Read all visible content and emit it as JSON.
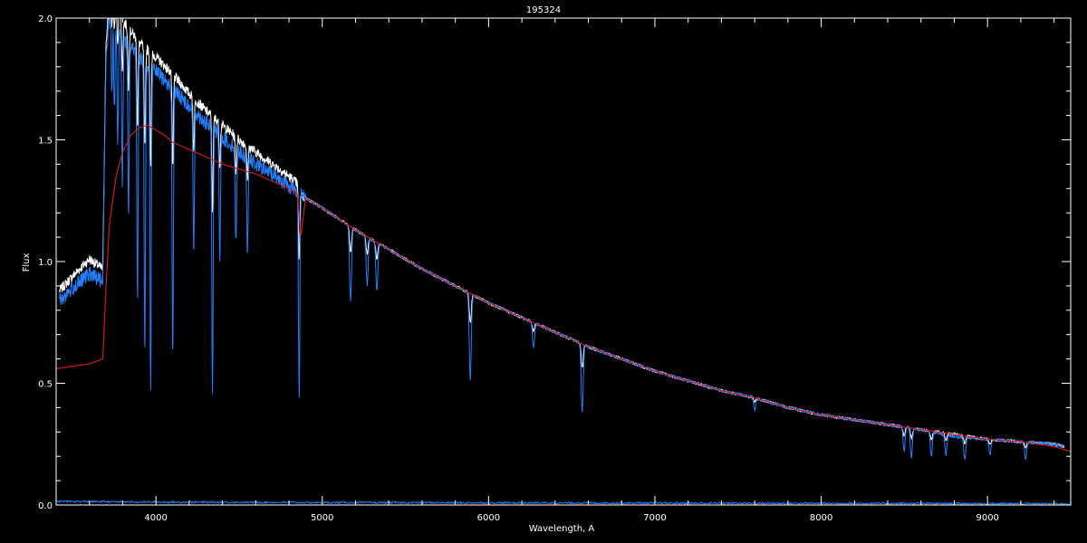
{
  "chart_data": {
    "type": "line",
    "title": "195324",
    "xlabel": "Wavelength, A",
    "ylabel": "Flux",
    "xlim": [
      3400,
      9500
    ],
    "ylim": [
      0.0,
      2.0
    ],
    "xticks": [
      4000,
      5000,
      6000,
      7000,
      8000,
      9000
    ],
    "xtick_labels": [
      "4000",
      "5000",
      "6000",
      "7000",
      "8000",
      "9000"
    ],
    "yticks": [
      0.0,
      0.5,
      1.0,
      1.5,
      2.0
    ],
    "ytick_labels": [
      "0.0",
      "0.5",
      "1.0",
      "1.5",
      "2.0"
    ],
    "grid": false,
    "background": "#000000",
    "axis_color": "#ffffff",
    "series": [
      {
        "color": "#ffffff",
        "width": 1,
        "x": [
          3420,
          3500,
          3600,
          3680,
          3700,
          3720,
          3750,
          3800,
          3900,
          4000,
          4100,
          4200,
          4300,
          4400,
          4500,
          4600,
          4700,
          4800,
          4850,
          4880,
          5000,
          5200,
          5400,
          5600,
          5800,
          6000,
          6200,
          6400,
          6600,
          6800,
          7000,
          7200,
          7400,
          7600,
          7800,
          8000,
          8200,
          8400,
          8600,
          8800,
          9000,
          9200,
          9400,
          9460
        ],
        "y": [
          0.88,
          0.94,
          1.01,
          0.97,
          1.9,
          2.05,
          2.1,
          1.99,
          1.9,
          1.84,
          1.77,
          1.69,
          1.62,
          1.56,
          1.5,
          1.45,
          1.4,
          1.35,
          1.32,
          1.27,
          1.22,
          1.13,
          1.05,
          0.97,
          0.9,
          0.83,
          0.77,
          0.71,
          0.65,
          0.6,
          0.55,
          0.51,
          0.47,
          0.44,
          0.4,
          0.37,
          0.35,
          0.33,
          0.31,
          0.29,
          0.27,
          0.26,
          0.25,
          0.24
        ]
      },
      {
        "color": "#1e7fff",
        "width": 1,
        "x": [
          3420,
          3500,
          3600,
          3680,
          3700,
          3720,
          3750,
          3800,
          3900,
          4000,
          4100,
          4200,
          4300,
          4400,
          4500,
          4600,
          4700,
          4800,
          4850,
          4880,
          5000,
          5200,
          5400,
          5600,
          5800,
          6000,
          6200,
          6400,
          6600,
          6800,
          7000,
          7200,
          7400,
          7600,
          7800,
          8000,
          8200,
          8400,
          8600,
          8800,
          9000,
          9200,
          9400,
          9460
        ],
        "y": [
          0.84,
          0.89,
          0.95,
          0.92,
          1.85,
          2.0,
          2.02,
          1.92,
          1.84,
          1.78,
          1.71,
          1.64,
          1.57,
          1.51,
          1.45,
          1.4,
          1.36,
          1.31,
          1.29,
          1.27,
          1.22,
          1.13,
          1.05,
          0.97,
          0.9,
          0.83,
          0.77,
          0.71,
          0.65,
          0.6,
          0.55,
          0.51,
          0.47,
          0.44,
          0.4,
          0.37,
          0.35,
          0.33,
          0.31,
          0.28,
          0.27,
          0.26,
          0.25,
          0.24
        ]
      },
      {
        "color": "#d01a1a",
        "width": 1.2,
        "x": [
          3400,
          3500,
          3600,
          3680,
          3700,
          3720,
          3760,
          3800,
          3850,
          3900,
          3950,
          4000,
          4050,
          4100,
          4200,
          4300,
          4400,
          4500,
          4600,
          4700,
          4800,
          4850,
          4870,
          4900,
          5000,
          5200,
          5400,
          5600,
          5800,
          6000,
          6200,
          6400,
          6600,
          6800,
          7000,
          7200,
          7400,
          7600,
          7800,
          8000,
          8200,
          8400,
          8600,
          8800,
          9000,
          9200,
          9400,
          9500
        ],
        "y": [
          0.56,
          0.57,
          0.58,
          0.6,
          0.9,
          1.15,
          1.35,
          1.45,
          1.52,
          1.55,
          1.56,
          1.54,
          1.52,
          1.49,
          1.46,
          1.43,
          1.4,
          1.38,
          1.36,
          1.33,
          1.3,
          1.28,
          1.1,
          1.26,
          1.22,
          1.13,
          1.05,
          0.97,
          0.9,
          0.83,
          0.77,
          0.71,
          0.65,
          0.6,
          0.55,
          0.51,
          0.47,
          0.44,
          0.4,
          0.37,
          0.35,
          0.33,
          0.31,
          0.29,
          0.27,
          0.26,
          0.24,
          0.22
        ]
      },
      {
        "color": "#1e7fff",
        "width": 1,
        "x": [
          3400,
          4000,
          5000,
          6000,
          7000,
          8000,
          9000,
          9500
        ],
        "y": [
          0.015,
          0.012,
          0.01,
          0.009,
          0.008,
          0.007,
          0.006,
          0.005
        ]
      }
    ],
    "absorption_lines": [
      {
        "x": 3735,
        "depth": 0.3
      },
      {
        "x": 3750,
        "depth": 0.4
      },
      {
        "x": 3770,
        "depth": 0.5
      },
      {
        "x": 3798,
        "depth": 0.6
      },
      {
        "x": 3835,
        "depth": 0.7
      },
      {
        "x": 3889,
        "depth": 1.0
      },
      {
        "x": 3933,
        "depth": 1.2
      },
      {
        "x": 3968,
        "depth": 1.3
      },
      {
        "x": 4101,
        "depth": 1.1
      },
      {
        "x": 4227,
        "depth": 0.6
      },
      {
        "x": 4340,
        "depth": 1.1
      },
      {
        "x": 4384,
        "depth": 0.5
      },
      {
        "x": 4481,
        "depth": 0.4
      },
      {
        "x": 4550,
        "depth": 0.4
      },
      {
        "x": 4861,
        "depth": 0.85
      },
      {
        "x": 5170,
        "depth": 0.3
      },
      {
        "x": 5270,
        "depth": 0.2
      },
      {
        "x": 5328,
        "depth": 0.2
      },
      {
        "x": 5890,
        "depth": 0.35
      },
      {
        "x": 6270,
        "depth": 0.1
      },
      {
        "x": 6563,
        "depth": 0.28
      },
      {
        "x": 7600,
        "depth": 0.05
      },
      {
        "x": 8498,
        "depth": 0.1
      },
      {
        "x": 8542,
        "depth": 0.12
      },
      {
        "x": 8662,
        "depth": 0.1
      },
      {
        "x": 8750,
        "depth": 0.08
      },
      {
        "x": 8863,
        "depth": 0.09
      },
      {
        "x": 9015,
        "depth": 0.06
      },
      {
        "x": 9229,
        "depth": 0.07
      }
    ]
  }
}
